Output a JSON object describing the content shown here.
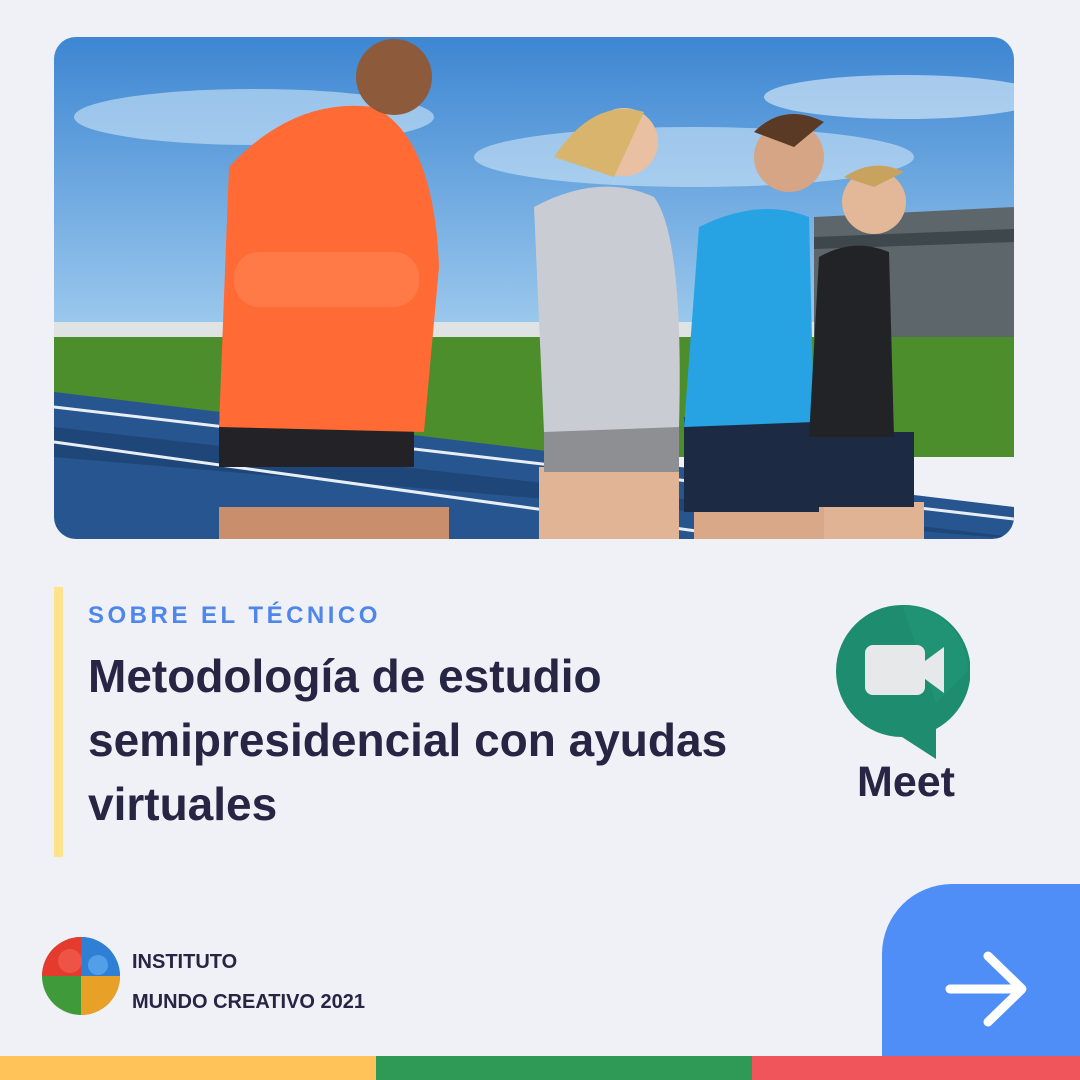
{
  "eyebrow": "SOBRE EL TÉCNICO",
  "headline": "Metodología de estudio semipresidencial con ayudas virtuales",
  "meet": {
    "label": "Meet"
  },
  "institute": {
    "line1": "INSTITUTO",
    "line2": "MUNDO CREATIVO 2021"
  },
  "next_button": {
    "icon": "arrow-right-icon"
  },
  "colors": {
    "background": "#eff1f7",
    "eyebrow": "#4f86ea",
    "text": "#262544",
    "accent_bar": "#ffe38a",
    "button": "#4f8ef7",
    "stripe_yellow": "#ffc35a",
    "stripe_green": "#2f9a55",
    "stripe_red": "#f0555b"
  }
}
